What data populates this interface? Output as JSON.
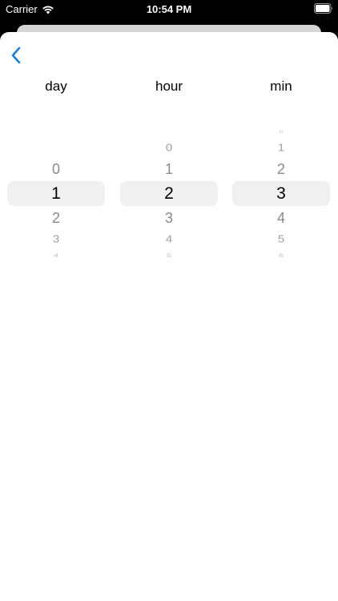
{
  "status_bar": {
    "carrier": "Carrier",
    "time": "10:54 PM"
  },
  "header": {
    "back_icon": "chevron-left-icon",
    "accent_color": "#1a7fe5"
  },
  "columns": [
    {
      "title": "day",
      "above": [
        "0"
      ],
      "selected": "1",
      "below": [
        "2",
        "3",
        "4"
      ]
    },
    {
      "title": "hour",
      "above": [
        "0",
        "1"
      ],
      "selected": "2",
      "below": [
        "3",
        "4",
        "5"
      ]
    },
    {
      "title": "min",
      "above": [
        "0",
        "1",
        "2"
      ],
      "selected": "3",
      "below": [
        "4",
        "5",
        "6"
      ]
    }
  ]
}
